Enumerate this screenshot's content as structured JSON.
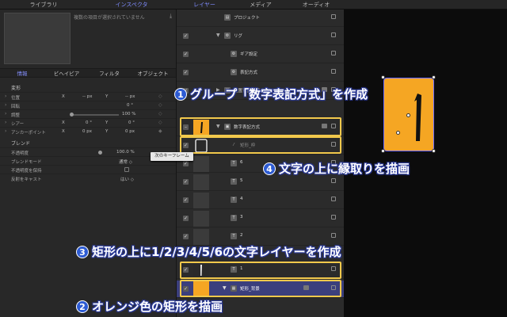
{
  "tabs": {
    "library": "ライブラリ",
    "inspector": "インスペクタ",
    "layers": "レイヤー",
    "media": "メディア",
    "audio": "オーディオ"
  },
  "inspector": {
    "no_selection": "複数の項目が選択されていません",
    "subtabs": [
      "情報",
      "ビヘイビア",
      "フィルタ",
      "オブジェクト"
    ],
    "transform": {
      "title": "変形",
      "position": {
        "label": "位置",
        "x_label": "X",
        "x_value": "-- px",
        "y_label": "Y",
        "y_value": "-- px"
      },
      "rotation": {
        "label": "回転",
        "value": "0 °"
      },
      "scale": {
        "label": "調整",
        "value": "100 %"
      },
      "shear": {
        "label": "シアー",
        "x_label": "X",
        "x_value": "0 °",
        "y_label": "Y",
        "y_value": "0 °"
      },
      "anchor": {
        "label": "アンカーポイント",
        "x_label": "X",
        "x_value": "0 px",
        "y_label": "Y",
        "y_value": "0 px"
      }
    },
    "blend": {
      "title": "ブレンド",
      "opacity": {
        "label": "不透明度",
        "value": "100.0 %"
      },
      "blend_mode": {
        "label": "ブレンドモード",
        "value": "通常 ◇"
      },
      "preserve_opacity": {
        "label": "不透明度を保持"
      },
      "cast_reflection": {
        "label": "反射をキャスト",
        "value": "はい ◇"
      }
    },
    "tooltip": "次のキーフレーム"
  },
  "layers": {
    "rows": [
      {
        "name": "プロジェクト",
        "icon": "project-icon"
      },
      {
        "name": "リグ",
        "icon": "rig-icon"
      },
      {
        "name": "ギア設定",
        "icon": "gear-widget-icon"
      },
      {
        "name": "表記方式",
        "icon": "widget-icon"
      },
      {
        "name": "位置表記方式",
        "icon": "group-icon"
      },
      {
        "name": "数字表記方式",
        "icon": "group-icon"
      },
      {
        "name": "矩形_枠",
        "icon": "shape-icon"
      },
      {
        "name": "6",
        "icon": "text-icon"
      },
      {
        "name": "5",
        "icon": "text-icon"
      },
      {
        "name": "4",
        "icon": "text-icon"
      },
      {
        "name": "3",
        "icon": "text-icon"
      },
      {
        "name": "2",
        "icon": "text-icon"
      },
      {
        "name": "1",
        "icon": "text-icon"
      },
      {
        "name": "矩形_背景",
        "icon": "shape-icon"
      }
    ],
    "behind_callout_hint": "アニメーション"
  },
  "callouts": [
    {
      "num": "1",
      "text": "グループ「数字表記方式」を作成"
    },
    {
      "num": "2",
      "text": "オレンジ色の矩形を描画"
    },
    {
      "num": "3",
      "text": "矩形の上に1/2/3/4/5/6の文字レイヤーを作成"
    },
    {
      "num": "4",
      "text": "文字の上に縁取りを描画"
    }
  ],
  "colors": {
    "accent": "#7f8cff",
    "selection": "#3b3f7d",
    "highlight": "#f2c94c",
    "orange": "#f5a623",
    "callout_badge": "#2d5bd3"
  }
}
